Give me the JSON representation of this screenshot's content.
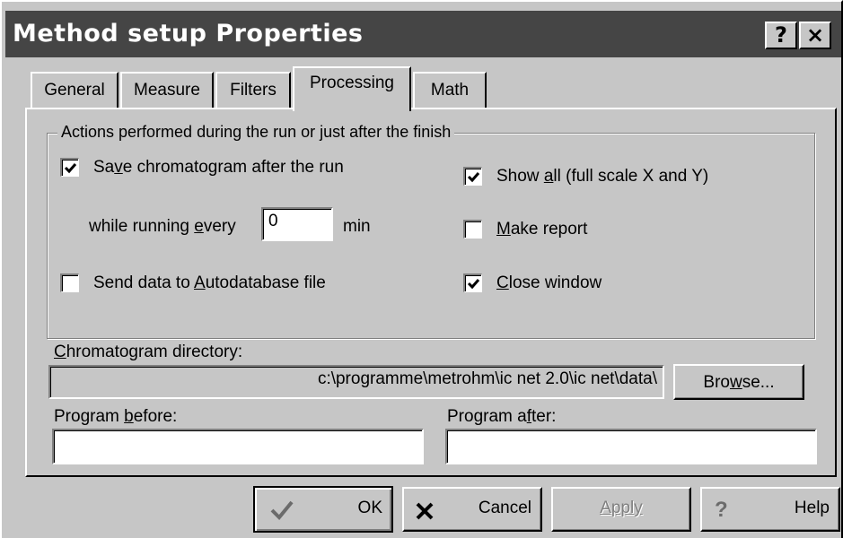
{
  "window": {
    "title": "Method setup Properties",
    "help_glyph": "?",
    "close_glyph": "×"
  },
  "tabs": [
    {
      "label": "General",
      "active": false
    },
    {
      "label": "Measure",
      "active": false
    },
    {
      "label": "Filters",
      "active": false
    },
    {
      "label": "Processing",
      "active": true
    },
    {
      "label": "Math",
      "active": false
    }
  ],
  "actions_group": {
    "title": "Actions performed during the run or just after the finish",
    "save_chromatogram": {
      "pre": "Sa",
      "key": "v",
      "post": "e chromatogram after the run",
      "checked": true
    },
    "while_running": {
      "pre": "while running ",
      "key": "e",
      "post": "very",
      "value": "0",
      "unit": "min"
    },
    "send_autodatabase": {
      "pre": "Send data to ",
      "key": "A",
      "post": "utodatabase file",
      "checked": false
    },
    "show_all": {
      "pre": "Show ",
      "key": "a",
      "post": "ll (full scale X and Y)",
      "checked": true
    },
    "make_report": {
      "pre": "",
      "key": "M",
      "post": "ake report",
      "checked": false
    },
    "close_window": {
      "pre": "",
      "key": "C",
      "post": "lose window",
      "checked": true
    }
  },
  "chromatogram_directory": {
    "label_key": "C",
    "label_rest": "hromatogram directory:",
    "value": "c:\\programme\\metrohm\\ic net 2.0\\ic net\\data\\",
    "browse_pre": "Bro",
    "browse_key": "w",
    "browse_post": "se..."
  },
  "program_before": {
    "pre": "Program ",
    "key": "b",
    "post": "efore:",
    "value": ""
  },
  "program_after": {
    "pre": "Program a",
    "key": "f",
    "post": "ter:",
    "value": ""
  },
  "buttons": {
    "ok": {
      "label": "OK",
      "icon": "checkmark-icon"
    },
    "cancel": {
      "label": "Cancel",
      "icon": "x-icon"
    },
    "apply": {
      "label": "Apply",
      "enabled": false
    },
    "help": {
      "label": "Help",
      "icon": "question-icon"
    }
  }
}
